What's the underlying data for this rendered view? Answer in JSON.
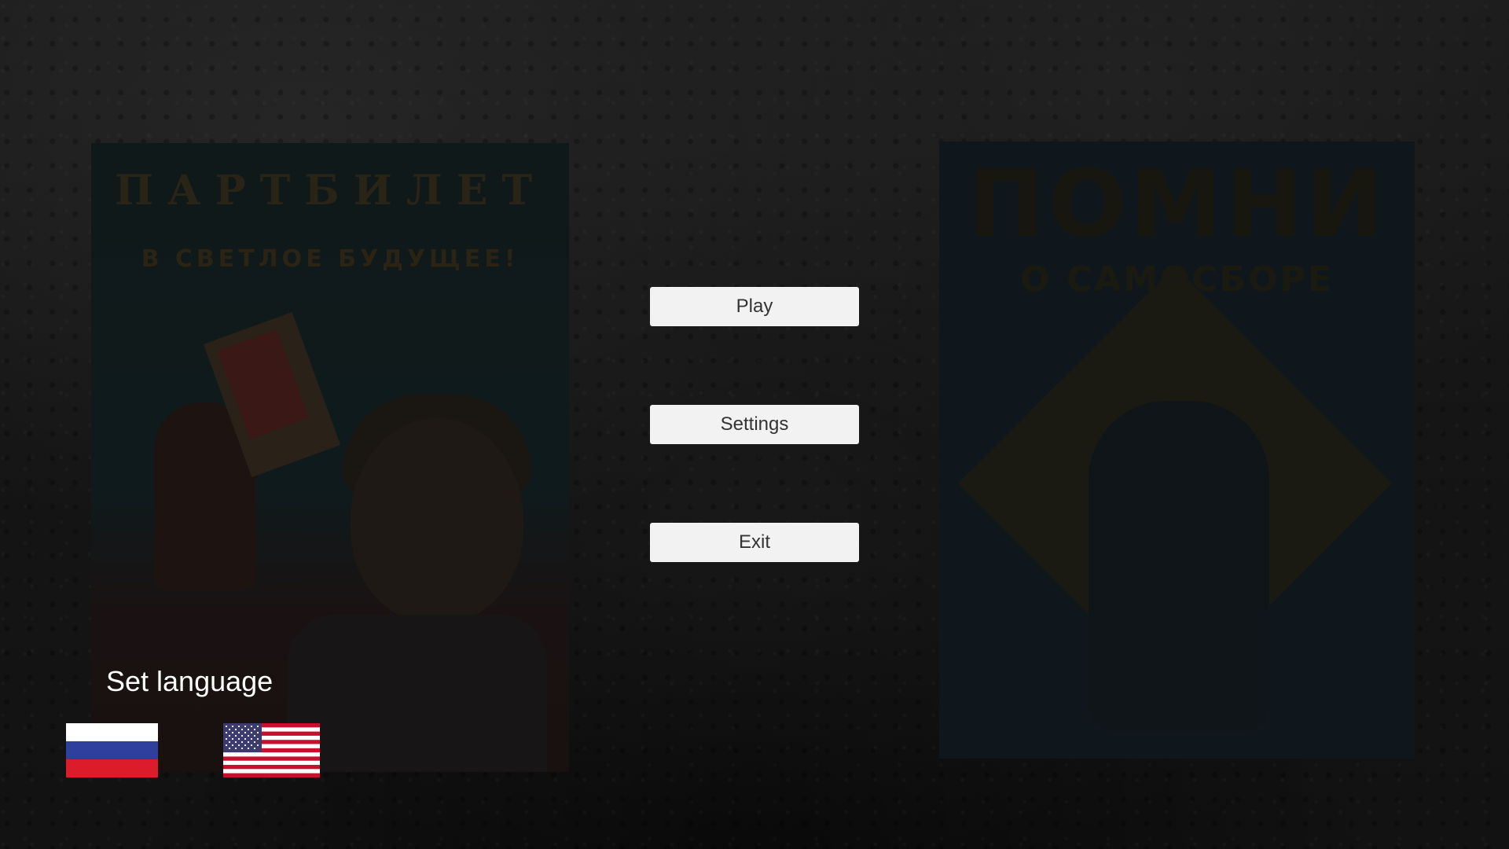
{
  "menu": {
    "play_label": "Play",
    "settings_label": "Settings",
    "exit_label": "Exit"
  },
  "language": {
    "label": "Set language",
    "options": [
      {
        "name": "russian-flag",
        "icon": "russia-flag-icon"
      },
      {
        "name": "english-flag",
        "icon": "usa-flag-icon"
      }
    ]
  },
  "posters": {
    "left": {
      "headline": "ПАРТБИЛЕТ",
      "tagline": "В СВЕТЛОЕ БУДУЩЕЕ!"
    },
    "right": {
      "headline": "ПОМНИ",
      "tagline": "О САМОСБОРЕ"
    }
  },
  "colors": {
    "button_bg": "#f2f2f2",
    "button_text": "#333333",
    "label_text": "#ffffff"
  }
}
